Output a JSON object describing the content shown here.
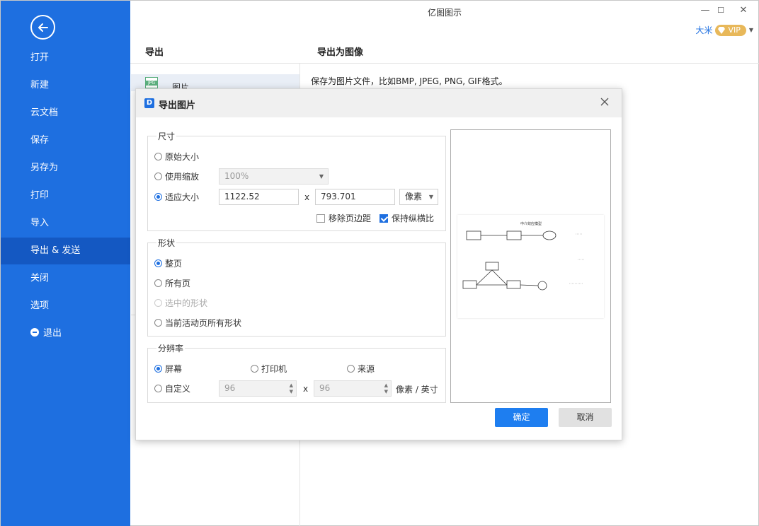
{
  "window": {
    "title": "亿图图示",
    "minimize": "—",
    "maximize": "☐",
    "close": "✕"
  },
  "user": {
    "name": "大米",
    "badge": "VIP"
  },
  "sidebar": {
    "items": [
      {
        "label": "打开"
      },
      {
        "label": "新建"
      },
      {
        "label": "云文档"
      },
      {
        "label": "保存"
      },
      {
        "label": "另存为"
      },
      {
        "label": "打印"
      },
      {
        "label": "导入"
      },
      {
        "label": "导出 & 发送",
        "active": true
      },
      {
        "label": "关闭"
      },
      {
        "label": "选项"
      },
      {
        "label": "退出"
      }
    ]
  },
  "middle": {
    "header": "导出",
    "item_label": "图片",
    "item_icon": "JPG"
  },
  "right": {
    "header": "导出为图像",
    "description": "保存为图片文件，比如BMP, JPEG, PNG, GIF格式。"
  },
  "dialog": {
    "logo": "D",
    "title": "导出图片",
    "size": {
      "legend": "尺寸",
      "original": "原始大小",
      "use_zoom": "使用缩放",
      "zoom_value": "100%",
      "fit": "适应大小",
      "width": "1122.52",
      "x": "x",
      "height": "793.701",
      "unit": "像素",
      "remove_margin": "移除页边距",
      "keep_ratio": "保持纵横比"
    },
    "shape": {
      "legend": "形状",
      "whole_page": "整页",
      "all_pages": "所有页",
      "selected": "选中的形状",
      "current_page_all": "当前活动页所有形状"
    },
    "resolution": {
      "legend": "分辨率",
      "screen": "屏幕",
      "printer": "打印机",
      "source": "来源",
      "custom": "自定义",
      "dpi_x": "96",
      "x": "x",
      "dpi_y": "96",
      "unit": "像素 / 英寸"
    },
    "preview_title": "中介效应模型",
    "ok": "确定",
    "cancel": "取消"
  }
}
